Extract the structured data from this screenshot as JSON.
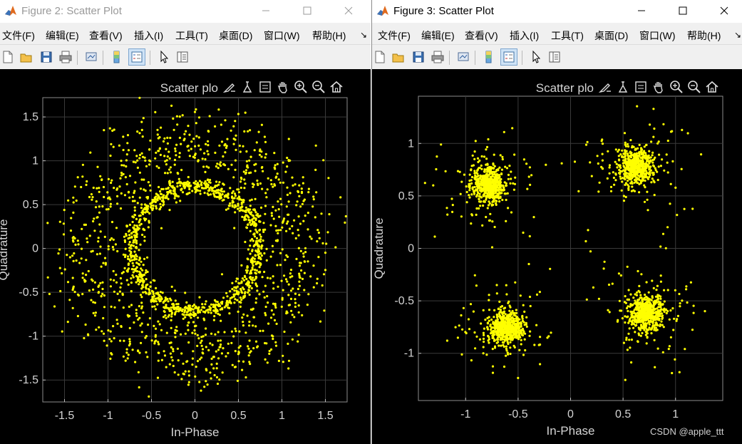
{
  "windows": [
    {
      "id": "win1",
      "title": "Figure 2: Scatter Plot",
      "active": false,
      "menu": [
        "文件(F)",
        "编辑(E)",
        "查看(V)",
        "插入(I)",
        "工具(T)",
        "桌面(D)",
        "窗口(W)",
        "帮助(H)"
      ],
      "toolbar_icons": [
        "new-figure-icon",
        "open-file-icon",
        "save-icon",
        "print-icon",
        "link-plot-icon",
        "insert-colorbar-icon",
        "insert-legend-icon",
        "edit-pointer-icon",
        "property-inspector-icon"
      ],
      "axes_toolbar_icons": [
        "brush-icon",
        "data-tips-icon",
        "datatip-cursor-icon",
        "pan-icon",
        "zoom-in-icon",
        "zoom-out-icon",
        "home-icon"
      ],
      "axes_title_partial": "Scatter plo",
      "chart_data": {
        "type": "scatter",
        "title": "Scatter plot",
        "xlabel": "In-Phase",
        "ylabel": "Quadrature",
        "xlim": [
          -1.75,
          1.75
        ],
        "ylim": [
          -1.75,
          1.72
        ],
        "xticks": [
          -1.5,
          -1,
          -0.5,
          0,
          0.5,
          1,
          1.5
        ],
        "xtick_labels": [
          "-1.5",
          "-1",
          "-0.5",
          "0",
          "0.5",
          "1",
          "1.5"
        ],
        "yticks": [
          -1.5,
          -1,
          -0.5,
          0,
          0.5,
          1,
          1.5
        ],
        "ytick_labels": [
          "-1.5",
          "-1",
          "-0.5",
          "0",
          "0.5",
          "1",
          "1.5"
        ],
        "grid": true,
        "marker_color": "#ffff00",
        "series": [
          {
            "shape": "ring",
            "center": [
              0,
              0
            ],
            "radius": 0.72,
            "spread": 0.05,
            "count": 950
          },
          {
            "shape": "ring",
            "center": [
              0,
              0
            ],
            "radius": 1.2,
            "spread": 0.24,
            "count": 1050
          }
        ]
      }
    },
    {
      "id": "win2",
      "title": "Figure 3: Scatter Plot",
      "active": true,
      "menu": [
        "文件(F)",
        "编辑(E)",
        "查看(V)",
        "插入(I)",
        "工具(T)",
        "桌面(D)",
        "窗口(W)",
        "帮助(H)"
      ],
      "toolbar_icons": [
        "new-figure-icon",
        "open-file-icon",
        "save-icon",
        "print-icon",
        "link-plot-icon",
        "insert-colorbar-icon",
        "insert-legend-icon",
        "edit-pointer-icon",
        "property-inspector-icon"
      ],
      "axes_toolbar_icons": [
        "brush-icon",
        "data-tips-icon",
        "datatip-cursor-icon",
        "pan-icon",
        "zoom-in-icon",
        "zoom-out-icon",
        "home-icon"
      ],
      "axes_title_partial": "Scatter plo",
      "chart_data": {
        "type": "scatter",
        "title": "Scatter plot",
        "xlabel": "In-Phase",
        "ylabel": "Quadrature",
        "xlim": [
          -1.45,
          1.45
        ],
        "ylim": [
          -1.45,
          1.45
        ],
        "xticks": [
          -1,
          -0.5,
          0,
          0.5,
          1
        ],
        "xtick_labels": [
          "-1",
          "-0.5",
          "0",
          "0.5",
          "1"
        ],
        "yticks": [
          -1,
          -0.5,
          0,
          0.5,
          1
        ],
        "ytick_labels": [
          "-1",
          "-0.5",
          "0",
          "0.5",
          "1"
        ],
        "grid": true,
        "marker_color": "#ffff00",
        "series": [
          {
            "shape": "cluster",
            "center": [
              -0.78,
              0.61
            ],
            "spread": 0.08,
            "count": 520,
            "outer_spread": 0.24,
            "outer_count": 110
          },
          {
            "shape": "cluster",
            "center": [
              0.62,
              0.78
            ],
            "spread": 0.08,
            "count": 520,
            "outer_spread": 0.24,
            "outer_count": 110
          },
          {
            "shape": "cluster",
            "center": [
              -0.62,
              -0.75
            ],
            "spread": 0.08,
            "count": 520,
            "outer_spread": 0.24,
            "outer_count": 110
          },
          {
            "shape": "cluster",
            "center": [
              0.72,
              -0.62
            ],
            "spread": 0.08,
            "count": 520,
            "outer_spread": 0.24,
            "outer_count": 110
          }
        ]
      },
      "watermark": "CSDN @apple_ttt"
    }
  ],
  "colors": {
    "figure_bg": "#000000",
    "axes_bg": "#000000",
    "grid": "#3a3a3a",
    "text": "#d4d4d4",
    "marker": "#ffff00"
  }
}
